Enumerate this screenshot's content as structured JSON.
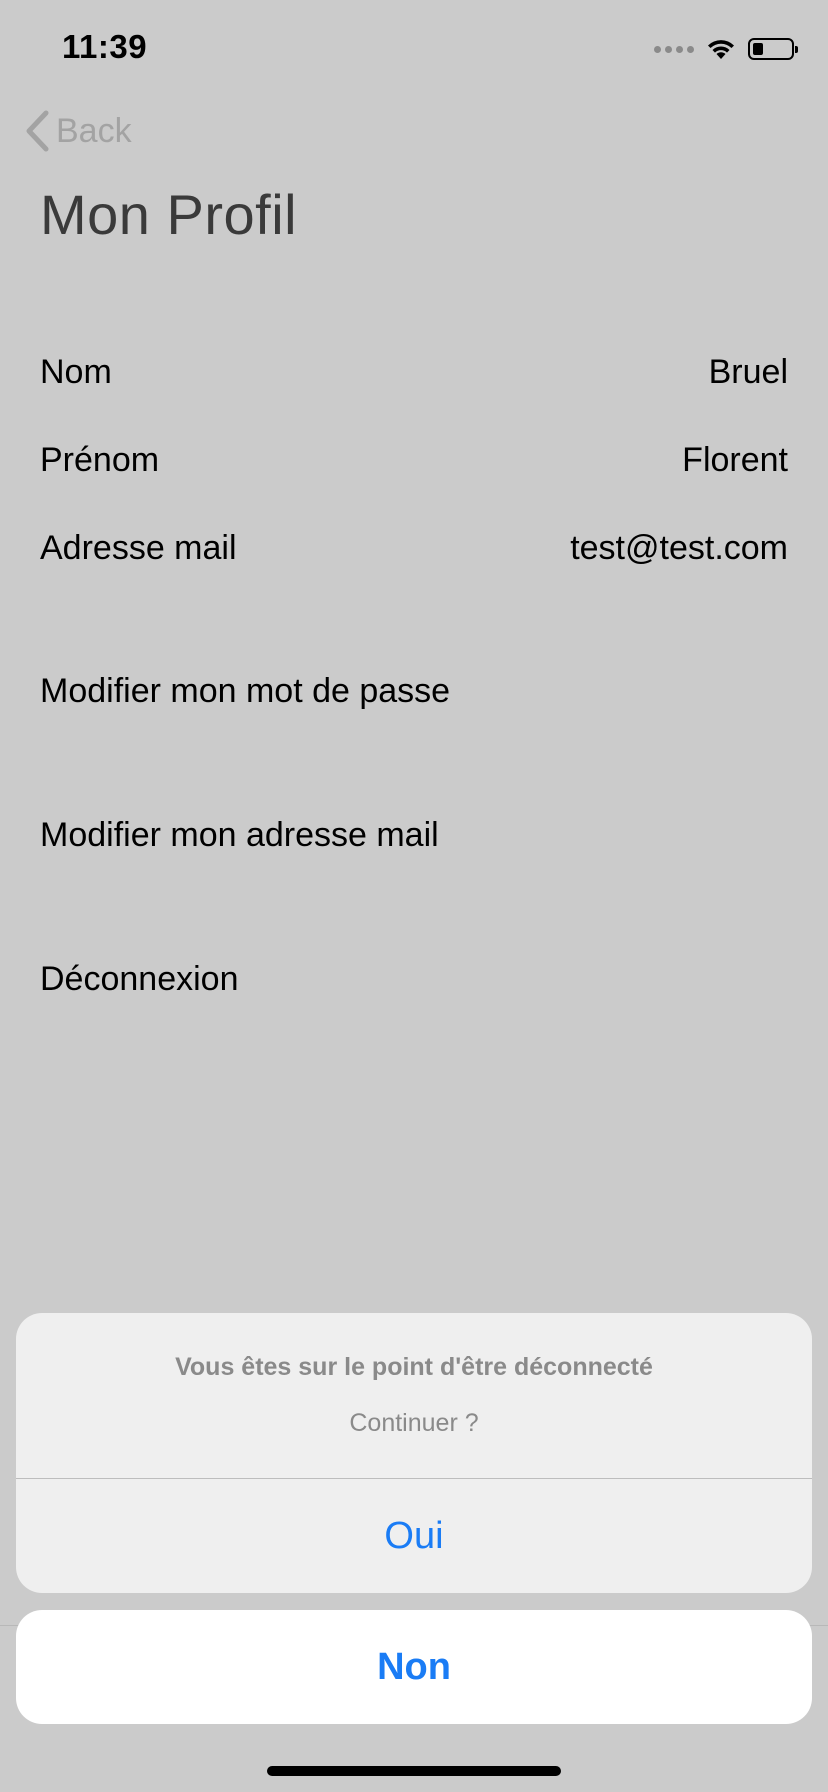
{
  "status_bar": {
    "time": "11:39"
  },
  "nav": {
    "back_label": "Back",
    "title": "Mon Profil"
  },
  "profile": {
    "rows": [
      {
        "label": "Nom",
        "value": "Bruel"
      },
      {
        "label": "Prénom",
        "value": "Florent"
      },
      {
        "label": "Adresse mail",
        "value": "test@test.com"
      }
    ]
  },
  "actions": {
    "change_password": "Modifier mon mot de passe",
    "change_email": "Modifier mon adresse mail",
    "logout": "Déconnexion"
  },
  "action_sheet": {
    "title": "Vous êtes sur le point d'être déconnecté",
    "message": "Continuer ?",
    "confirm_label": "Oui",
    "cancel_label": "Non"
  },
  "colors": {
    "accent": "#1a7cf5",
    "dimmed_background": "#cbcbcb"
  }
}
